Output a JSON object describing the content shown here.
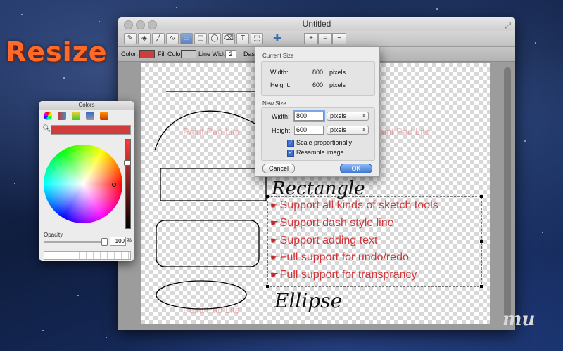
{
  "promo": {
    "title": "Resize"
  },
  "window": {
    "title": "Untitled"
  },
  "properties": {
    "color_label": "Color:",
    "fill_color_label": "Fill Color:",
    "line_width_label": "Line Width:",
    "line_width_value": "2",
    "dash_label": "Dash",
    "stroke_color": "#cf3c3c",
    "fill_color": "#c8c8c8"
  },
  "canvas": {
    "features": [
      "Support all kinds of sketch tools",
      "Support dash style line",
      "Support adding text",
      "Full support for undo/redo",
      "Full support for transprancy"
    ],
    "handwriting": {
      "rectangle": "Rectangle",
      "ellipse": "Ellipse"
    },
    "watermark": "Paint Pad Lite"
  },
  "colors_panel": {
    "title": "Colors",
    "current_color": "#cf3c3c",
    "opacity_label": "Opacity",
    "opacity_value": "100",
    "opacity_unit": "%"
  },
  "resize_sheet": {
    "current_size_title": "Current Size",
    "width_label": "Width:",
    "current_width": "800",
    "height_label": "Height:",
    "current_height": "600",
    "pixels_label": "pixels",
    "new_size_title": "New Size",
    "new_width_label": "Width:",
    "new_height_label": "Height",
    "new_width": "800",
    "new_height": "600",
    "unit_options": [
      "pixels",
      "pixels"
    ],
    "scale_label": "Scale proportionally",
    "resample_label": "Resample image",
    "cancel_label": "Cancel",
    "ok_label": "OK"
  },
  "brand": {
    "logo_text": "mu"
  }
}
